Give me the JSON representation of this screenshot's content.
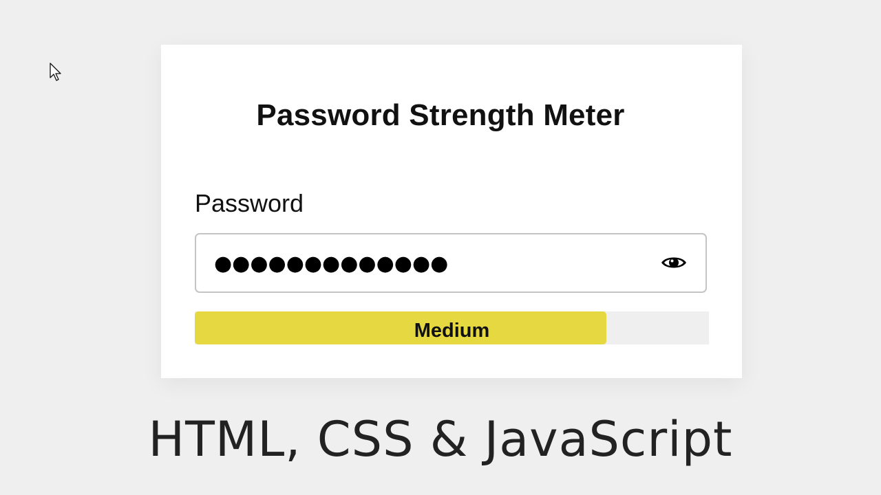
{
  "card": {
    "title": "Password Strength Meter",
    "password_label": "Password",
    "password_masked": "●●●●●●●●●●●●●",
    "visibility_icon": "eye-icon",
    "strength": {
      "label": "Medium",
      "fraction": 0.8,
      "color": "#e5d840",
      "track_color": "#efefef"
    }
  },
  "caption": "HTML, CSS & JavaScript",
  "colors": {
    "background": "#efefef",
    "card": "#ffffff",
    "text": "#111111"
  }
}
